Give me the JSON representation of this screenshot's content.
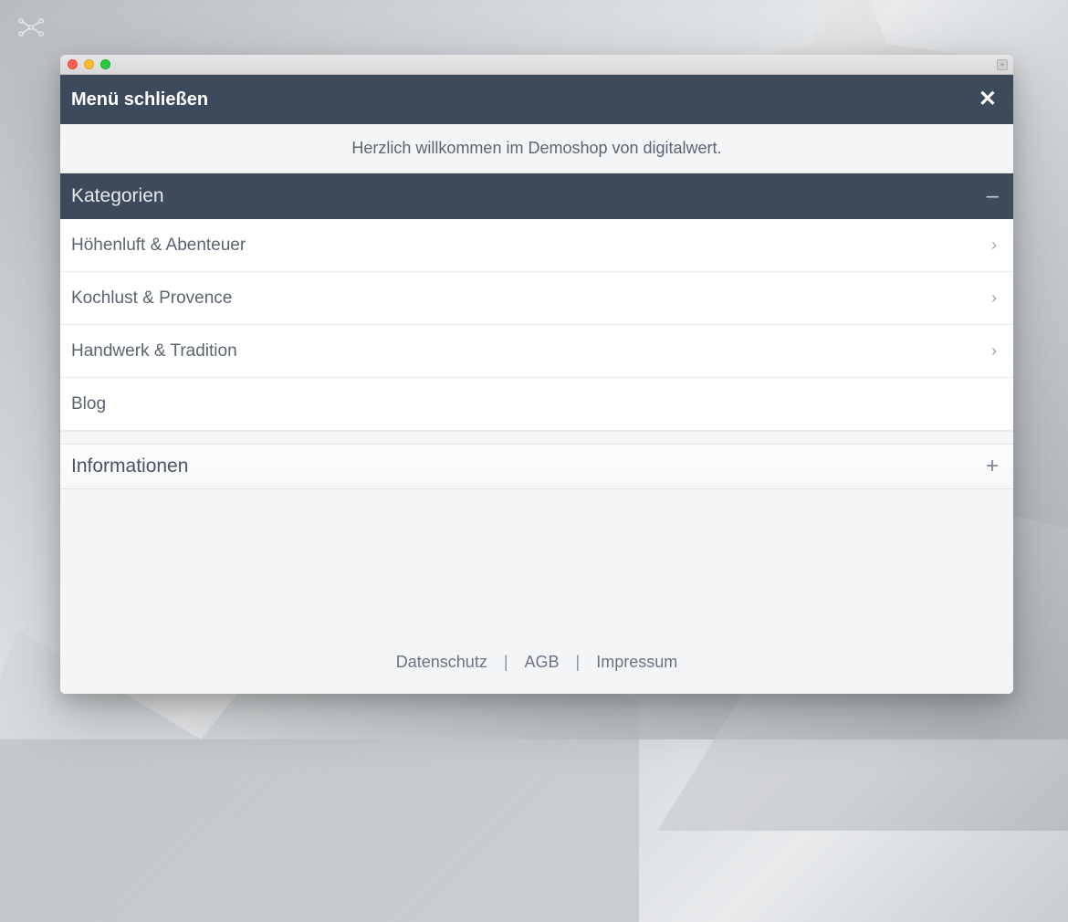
{
  "menu": {
    "close_label": "Menü schließen",
    "welcome_text": "Herzlich willkommen im Demoshop von digitalwert."
  },
  "sections": {
    "categories": {
      "title": "Kategorien",
      "expanded": true,
      "toggle_glyph": "–",
      "items": [
        {
          "label": "Höhenluft & Abenteuer",
          "has_children": true
        },
        {
          "label": "Kochlust & Provence",
          "has_children": true
        },
        {
          "label": "Handwerk & Tradition",
          "has_children": true
        },
        {
          "label": "Blog",
          "has_children": false
        }
      ]
    },
    "information": {
      "title": "Informationen",
      "expanded": false,
      "toggle_glyph": "+"
    }
  },
  "footer": {
    "links": [
      {
        "label": "Datenschutz"
      },
      {
        "label": "AGB"
      },
      {
        "label": "Impressum"
      }
    ],
    "separator": "|"
  },
  "icons": {
    "close": "✕",
    "chevron_right": "›"
  }
}
